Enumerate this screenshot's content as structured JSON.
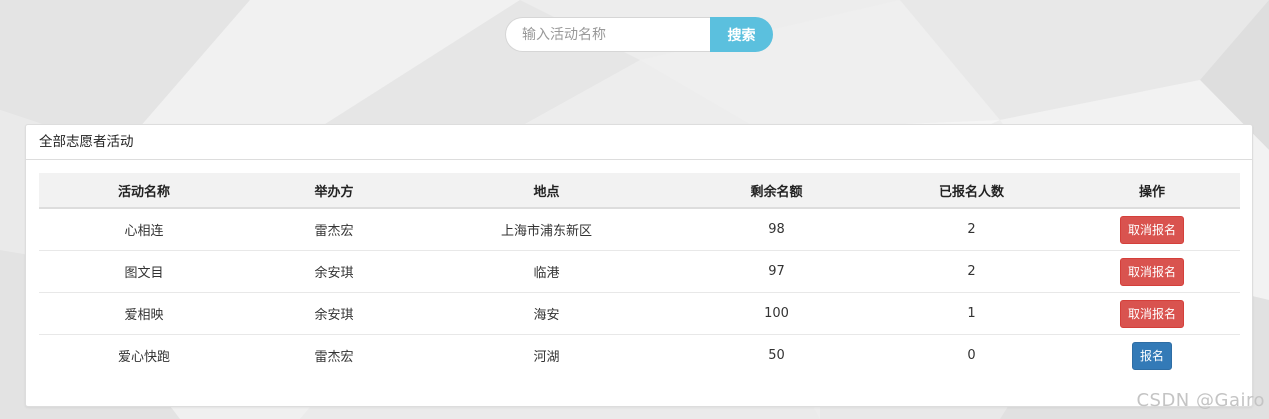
{
  "search": {
    "placeholder": "输入活动名称",
    "value": "",
    "button_label": "搜索"
  },
  "panel": {
    "title": "全部志愿者活动"
  },
  "table": {
    "columns": [
      "活动名称",
      "举办方",
      "地点",
      "剩余名额",
      "已报名人数",
      "操作"
    ],
    "rows": [
      {
        "name": "心相连",
        "organizer": "雷杰宏",
        "location": "上海市浦东新区",
        "remaining": "98",
        "enrolled": "2",
        "action": "取消报名",
        "action_type": "cancel"
      },
      {
        "name": "图文目",
        "organizer": "余安琪",
        "location": "临港",
        "remaining": "97",
        "enrolled": "2",
        "action": "取消报名",
        "action_type": "cancel"
      },
      {
        "name": "爱相映",
        "organizer": "余安琪",
        "location": "海安",
        "remaining": "100",
        "enrolled": "1",
        "action": "取消报名",
        "action_type": "cancel"
      },
      {
        "name": "爱心快跑",
        "organizer": "雷杰宏",
        "location": "河湖",
        "remaining": "50",
        "enrolled": "0",
        "action": "报名",
        "action_type": "signup"
      }
    ]
  },
  "colors": {
    "search_button": "#5bc0de",
    "cancel_button": "#d9534f",
    "signup_button": "#337ab7"
  },
  "watermark": "CSDN @Gairo"
}
